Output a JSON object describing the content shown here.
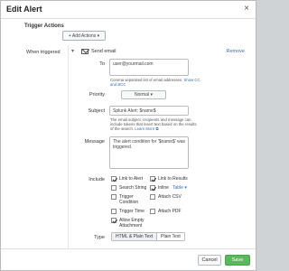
{
  "dialog": {
    "title": "Edit Alert",
    "close_glyph": "×"
  },
  "trigger_actions": {
    "section_title": "Trigger Actions",
    "add_actions_label": "+ Add Actions ▾",
    "when_triggered_label": "When triggered"
  },
  "action": {
    "name": "Send email",
    "remove_label": "Remove",
    "to_label": "To",
    "to_value": "user@yourmail.com",
    "to_help_prefix": "Comma separated list of email addresses.",
    "to_help_link": "Show CC and BCC",
    "priority_label": "Priority",
    "priority_value": "Normal ▾",
    "subject_label": "Subject",
    "subject_value": "Splunk Alert: $name$",
    "subject_help_prefix": "The email subject, recipients and message can include tokens that insert text based on the results of the search.",
    "subject_help_link": "Learn More ⧉",
    "message_label": "Message",
    "message_value": "The alert condition for '$name$' was triggered.",
    "include_label": "Include",
    "include_options": {
      "link_to_alert": "Link to Alert",
      "link_to_results": "Link to Results",
      "search_string": "Search String",
      "inline": "Inline",
      "inline_format": "Table ▾",
      "trigger_condition": "Trigger Condition",
      "attach_csv": "Attach CSV",
      "trigger_time": "Trigger Time",
      "attach_pdf": "Attach PDF",
      "allow_empty_attachment": "Allow Empty Attachment"
    },
    "type_label": "Type",
    "type_options": {
      "html_plain": "HTML & Plain Text",
      "plain": "Plain Text"
    }
  },
  "footer": {
    "cancel_label": "Cancel",
    "save_label": "Save"
  },
  "colors": {
    "save_green": "#5cb85c",
    "link_blue": "#3a6fb0"
  }
}
